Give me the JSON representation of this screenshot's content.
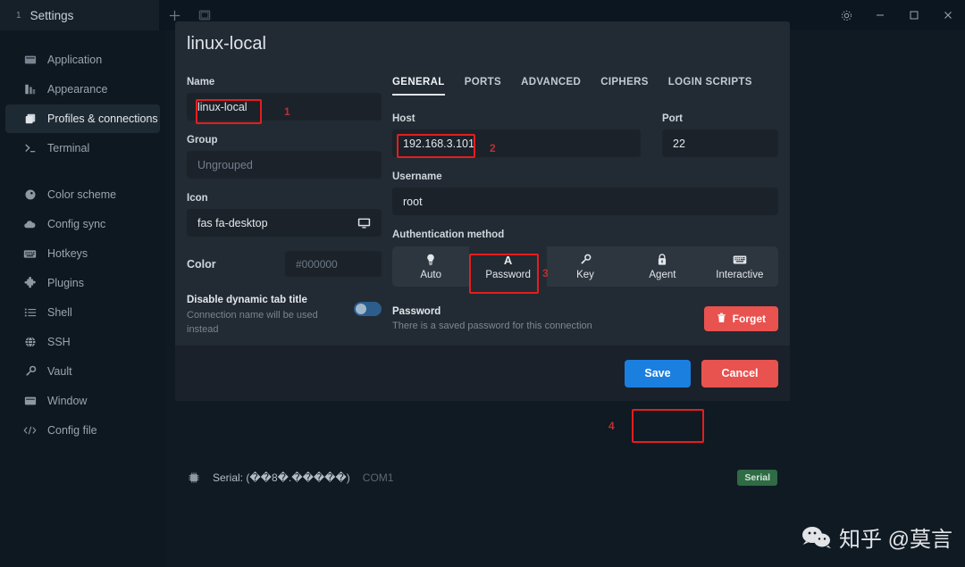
{
  "titlebar": {
    "tab": {
      "index": "1",
      "title": "Settings"
    },
    "new_tab_label": "+",
    "split_icon": "split-panel-icon",
    "gear_icon": "gear-icon",
    "minimize_icon": "minimize-icon",
    "maximize_icon": "maximize-icon",
    "close_icon": "close-icon"
  },
  "sidebar": {
    "items": [
      {
        "label": "Application",
        "icon": "application-icon",
        "active": false
      },
      {
        "label": "Appearance",
        "icon": "appearance-icon",
        "active": false
      },
      {
        "label": "Profiles & connections",
        "icon": "profiles-icon",
        "active": true
      },
      {
        "label": "Terminal",
        "icon": "terminal-icon",
        "active": false
      },
      {
        "label": "Color scheme",
        "icon": "palette-icon",
        "active": false
      },
      {
        "label": "Config sync",
        "icon": "cloud-icon",
        "active": false
      },
      {
        "label": "Hotkeys",
        "icon": "keyboard-icon",
        "active": false
      },
      {
        "label": "Plugins",
        "icon": "puzzle-icon",
        "active": false
      },
      {
        "label": "Shell",
        "icon": "list-icon",
        "active": false
      },
      {
        "label": "SSH",
        "icon": "globe-icon",
        "active": false
      },
      {
        "label": "Vault",
        "icon": "key-icon",
        "active": false
      },
      {
        "label": "Window",
        "icon": "window-icon",
        "active": false
      },
      {
        "label": "Config file",
        "icon": "code-icon",
        "active": false
      }
    ]
  },
  "dialog": {
    "title": "linux-local",
    "left": {
      "name_label": "Name",
      "name_value": "linux-local",
      "group_label": "Group",
      "group_placeholder": "Ungrouped",
      "icon_label": "Icon",
      "icon_value": "fas fa-desktop",
      "icon_preview": "desktop-icon",
      "color_label": "Color",
      "color_placeholder": "#000000",
      "toggle_title": "Disable dynamic tab title",
      "toggle_desc": "Connection name will be used instead",
      "toggle_state": "off"
    },
    "tabs": [
      {
        "label": "GENERAL",
        "active": true
      },
      {
        "label": "PORTS",
        "active": false
      },
      {
        "label": "ADVANCED",
        "active": false
      },
      {
        "label": "CIPHERS",
        "active": false
      },
      {
        "label": "LOGIN SCRIPTS",
        "active": false
      }
    ],
    "right": {
      "host_label": "Host",
      "host_value": "192.168.3.101",
      "port_label": "Port",
      "port_value": "22",
      "username_label": "Username",
      "username_value": "root",
      "auth_label": "Authentication method",
      "auth_methods": [
        {
          "label": "Auto",
          "icon": "lightbulb-icon",
          "selected": false
        },
        {
          "label": "Password",
          "icon": "letter-a-icon",
          "selected": true
        },
        {
          "label": "Key",
          "icon": "key-icon",
          "selected": false
        },
        {
          "label": "Agent",
          "icon": "agent-icon",
          "selected": false
        },
        {
          "label": "Interactive",
          "icon": "keyboard-icon",
          "selected": false
        }
      ],
      "password_title": "Password",
      "password_desc": "There is a saved password for this connection",
      "forget_label": "Forget",
      "forget_icon": "trash-icon"
    },
    "footer": {
      "save_label": "Save",
      "cancel_label": "Cancel"
    }
  },
  "status": {
    "icon": "chip-icon",
    "text": "Serial: (��8�.�����)",
    "port": "COM1",
    "badge": "Serial"
  },
  "annotations": {
    "markers": [
      "1",
      "2",
      "3",
      "4"
    ]
  },
  "watermark": {
    "text": "知乎 @莫言",
    "icon": "wechat-icon"
  },
  "colors": {
    "accent_blue": "#1b7fe0",
    "danger_red": "#e8524f",
    "annotation_red": "#e41e1e",
    "badge_green": "#2f6b44"
  }
}
